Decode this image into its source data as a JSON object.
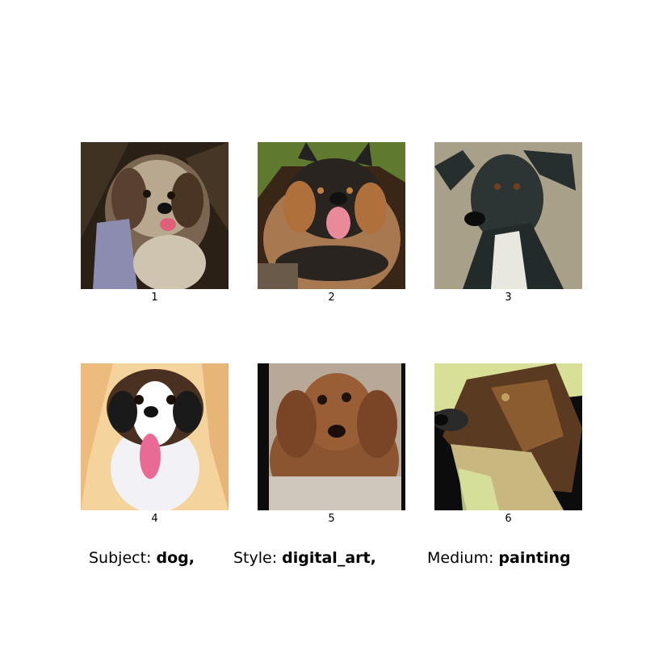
{
  "images": [
    {
      "label": "1",
      "subject": "dog"
    },
    {
      "label": "2",
      "subject": "dog"
    },
    {
      "label": "3",
      "subject": "dog"
    },
    {
      "label": "4",
      "subject": "dog"
    },
    {
      "label": "5",
      "subject": "dog"
    },
    {
      "label": "6",
      "subject": "dog"
    }
  ],
  "captions": {
    "subject_key": "Subject:",
    "subject_value": "dog,",
    "style_key": "Style:",
    "style_value": "digital_art,",
    "medium_key": "Medium:",
    "medium_value": "painting"
  }
}
